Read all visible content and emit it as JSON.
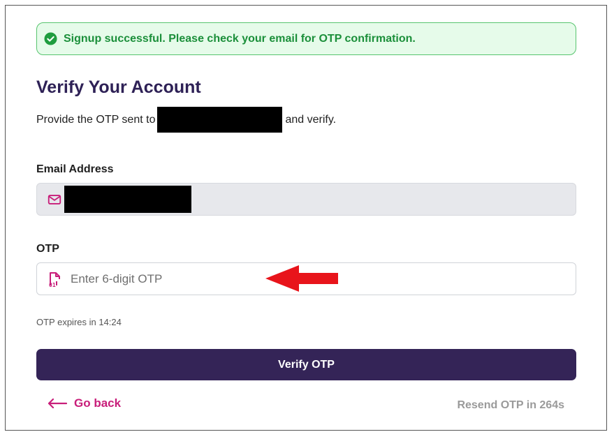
{
  "alert": {
    "icon": "check-circle-icon",
    "message": "Signup successful. Please check your email for OTP confirmation.",
    "color": "#1b8f3a",
    "background": "#e6fbea"
  },
  "header": {
    "title": "Verify Your Account",
    "subtitle_prefix": "Provide the OTP sent to",
    "subtitle_suffix": "and verify."
  },
  "email_field": {
    "label": "Email Address",
    "icon": "mail-icon",
    "value_redacted": true
  },
  "otp_field": {
    "label": "OTP",
    "icon": "binary-file-icon",
    "placeholder": "Enter 6-digit OTP",
    "value": ""
  },
  "annotation": {
    "icon": "red-arrow-left-icon",
    "color": "#e8141b"
  },
  "expiry": {
    "text": "OTP expires in 14:24"
  },
  "verify_button": {
    "label": "Verify OTP",
    "color": "#342457"
  },
  "footer": {
    "back_label": "Go back",
    "back_icon": "arrow-left-icon",
    "resend_label": "Resend OTP in 264s"
  }
}
